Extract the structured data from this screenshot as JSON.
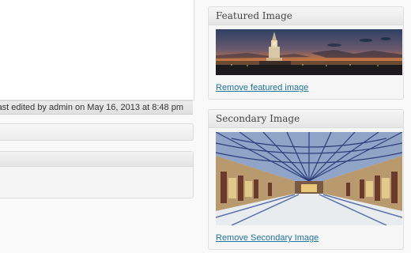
{
  "editor": {
    "last_edited": "ast edited by admin on May 16, 2013 at 8:48 pm"
  },
  "featured_image": {
    "title": "Featured Image",
    "image_icon": "sunset-clock-tower-image",
    "remove_label": "Remove featured image"
  },
  "secondary_image": {
    "title": "Secondary Image",
    "image_icon": "winter-gardens-arcade-image",
    "remove_label": "Remove Secondary Image"
  },
  "colors": {
    "link": "#21759b",
    "panel_bg": "#f6f6f6",
    "border": "#dfdfdf"
  }
}
